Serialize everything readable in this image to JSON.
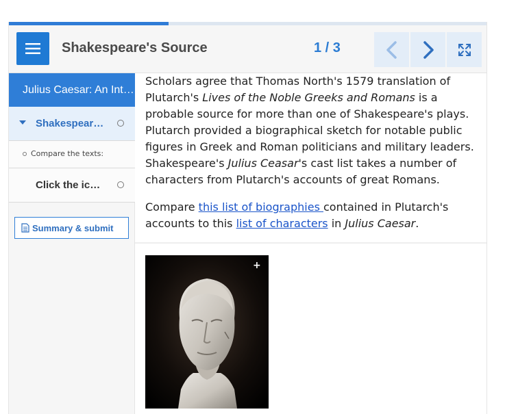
{
  "progress": {
    "fraction": 0.333
  },
  "header": {
    "title": "Shakespeare's Source",
    "counter": "1 / 3"
  },
  "icons": {
    "menu": "hamburger-menu-icon",
    "prev": "chevron-left-icon",
    "next": "chevron-right-icon",
    "fullscreen": "fullscreen-expand-icon",
    "summary": "document-icon",
    "image_expand": "plus-icon"
  },
  "sidebar": {
    "course_title": "Julius Caesar: An Interactive Guide",
    "chapters": [
      {
        "label": "Shakespeare's Source",
        "expanded": true,
        "sub_items": [
          "Compare the texts:"
        ]
      },
      {
        "label": "Click the icons",
        "expanded": false
      }
    ],
    "summary_label": "Summary & submit"
  },
  "content": {
    "p1_a": "Scholars agree that Thomas North's 1579 translation of Plutarch's ",
    "p1_em1": "Lives of the Noble Greeks and Romans",
    "p1_b": " is a probable source for more than one of Shakespeare's plays. Plutarch provided a biographical sketch for notable public figures in Greek and Roman politicians and military leaders. Shakespeare's ",
    "p1_em2": "Julius Ceasar",
    "p1_c": "'s cast list takes a number of characters from Plutarch's accounts of great Romans.",
    "p2_a": "Compare ",
    "p2_link1": "this list of biographies ",
    "p2_b": "contained in Plutarch's accounts to this ",
    "p2_link2": "list of characters",
    "p2_c": " in ",
    "p2_em": "Julius Caesar",
    "p2_d": "."
  },
  "colors": {
    "accent": "#2f7ed7",
    "accent_light": "#e3edf8",
    "link": "#1a54c9",
    "counter": "#2b7cd3"
  }
}
